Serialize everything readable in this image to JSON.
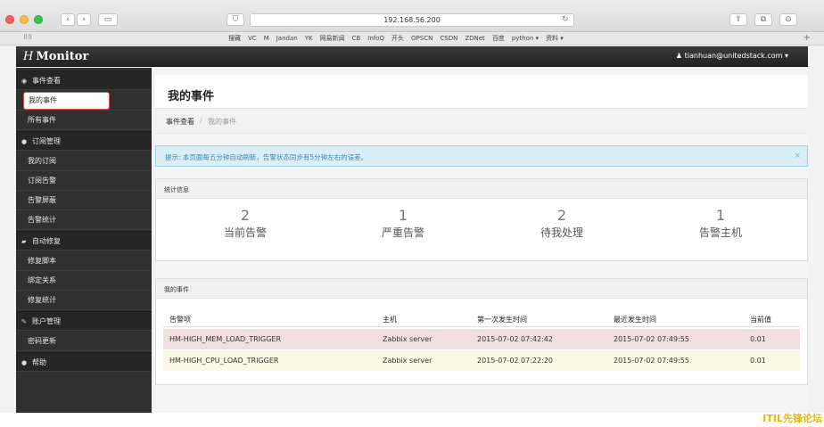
{
  "browser": {
    "url": "192.168.56.200",
    "bookmarks": [
      "搜藏",
      "VC",
      "M",
      "Jandan",
      "YK",
      "网易新闻",
      "CB",
      "InfoQ",
      "开头",
      "OPSCN",
      "CSDN",
      "ZDNet",
      "百度",
      "python ▾",
      "资料 ▾"
    ]
  },
  "app": {
    "brand_italic": "H",
    "brand": "Monitor",
    "user": "tianhuan@unitedstack.com ▾"
  },
  "sidebar": {
    "groups": [
      {
        "label": "事件查看",
        "icon": "eye-icon",
        "items": [
          "我的事件",
          "所有事件"
        ]
      },
      {
        "label": "订阅管理",
        "icon": "bullet-icon",
        "items": [
          "我的订阅",
          "订阅告警",
          "告警屏蔽",
          "告警统计"
        ]
      },
      {
        "label": "自动修复",
        "icon": "briefcase-icon",
        "items": [
          "修复脚本",
          "绑定关系",
          "修复统计"
        ]
      },
      {
        "label": "账户管理",
        "icon": "wrench-icon",
        "items": [
          "密码更新"
        ]
      },
      {
        "label": "帮助",
        "icon": "help-icon",
        "items": []
      }
    ],
    "active_item": "我的事件"
  },
  "page": {
    "title": "我的事件",
    "breadcrumb": {
      "parent": "事件查看",
      "current": "我的事件",
      "separator": "/"
    },
    "alert": {
      "text": "提示: 本页面每五分钟自动刷新，告警状态同步有5分钟左右的误差。",
      "close": "×"
    }
  },
  "stats": {
    "heading": "统计信息",
    "items": [
      {
        "value": "2",
        "label": "当前告警"
      },
      {
        "value": "1",
        "label": "严重告警"
      },
      {
        "value": "2",
        "label": "待我处理"
      },
      {
        "value": "1",
        "label": "告警主机"
      }
    ]
  },
  "events": {
    "heading": "我的事件",
    "columns": [
      "告警项",
      "主机",
      "第一次发生时间",
      "最近发生时间",
      "当前值"
    ],
    "rows": [
      {
        "item": "HM-HIGH_MEM_LOAD_TRIGGER",
        "host": "Zabbix server",
        "first": "2015-07-02 07:42:42",
        "last": "2015-07-02 07:49:55",
        "value": "0.01",
        "bg": "#f2dede"
      },
      {
        "item": "HM-HIGH_CPU_LOAD_TRIGGER",
        "host": "Zabbix server",
        "first": "2015-07-02 07:22:20",
        "last": "2015-07-02 07:49:55",
        "value": "0.01",
        "bg": "#fcf8e3"
      }
    ]
  },
  "watermark": "ITIL先锋论坛"
}
